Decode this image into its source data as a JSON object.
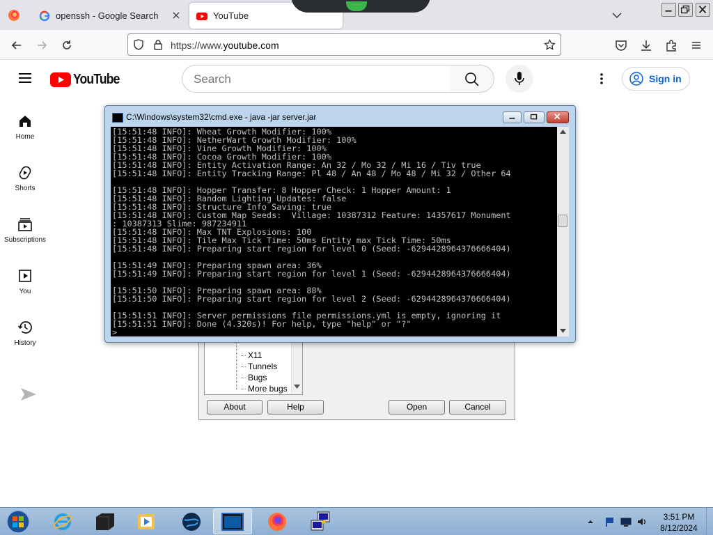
{
  "browser": {
    "tabs": [
      {
        "title": "openssh - Google Search"
      },
      {
        "title": "YouTube"
      }
    ],
    "url_scheme": "https://www.",
    "url_host": "youtube.com"
  },
  "youtube": {
    "logo_text": "YouTube",
    "search_placeholder": "Search",
    "sign_in_label": "Sign in",
    "sidebar": [
      {
        "label": "Home",
        "icon": "home-icon"
      },
      {
        "label": "Shorts",
        "icon": "shorts-icon"
      },
      {
        "label": "Subscriptions",
        "icon": "subscriptions-icon"
      },
      {
        "label": "You",
        "icon": "you-icon"
      },
      {
        "label": "History",
        "icon": "history-icon"
      }
    ],
    "brand_color": "#ff0000",
    "link_color": "#065fd4"
  },
  "dialog": {
    "tree_items": [
      "X11",
      "Tunnels",
      "Bugs",
      "More bugs"
    ],
    "buttons": {
      "about": "About",
      "help": "Help",
      "open": "Open",
      "cancel": "Cancel"
    }
  },
  "cmd": {
    "title": "C:\\Windows\\system32\\cmd.exe - java  -jar server.jar",
    "lines": [
      "[15:51:48 INFO]: Wheat Growth Modifier: 100%",
      "[15:51:48 INFO]: NetherWart Growth Modifier: 100%",
      "[15:51:48 INFO]: Vine Growth Modifier: 100%",
      "[15:51:48 INFO]: Cocoa Growth Modifier: 100%",
      "[15:51:48 INFO]: Entity Activation Range: An 32 / Mo 32 / Mi 16 / Tiv true",
      "[15:51:48 INFO]: Entity Tracking Range: Pl 48 / An 48 / Mo 48 / Mi 32 / Other 64",
      "",
      "[15:51:48 INFO]: Hopper Transfer: 8 Hopper Check: 1 Hopper Amount: 1",
      "[15:51:48 INFO]: Random Lighting Updates: false",
      "[15:51:48 INFO]: Structure Info Saving: true",
      "[15:51:48 INFO]: Custom Map Seeds:  Village: 10387312 Feature: 14357617 Monument",
      ": 10387313 Slime: 987234911",
      "[15:51:48 INFO]: Max TNT Explosions: 100",
      "[15:51:48 INFO]: Tile Max Tick Time: 50ms Entity max Tick Time: 50ms",
      "[15:51:48 INFO]: Preparing start region for level 0 (Seed: -6294428964376666404)",
      "",
      "[15:51:49 INFO]: Preparing spawn area: 36%",
      "[15:51:49 INFO]: Preparing start region for level 1 (Seed: -6294428964376666404)",
      "",
      "[15:51:50 INFO]: Preparing spawn area: 88%",
      "[15:51:50 INFO]: Preparing start region for level 2 (Seed: -6294428964376666404)",
      "",
      "[15:51:51 INFO]: Server permissions file permissions.yml is empty, ignoring it",
      "[15:51:51 INFO]: Done (4.320s)! For help, type \"help\" or \"?\"",
      ">"
    ]
  },
  "taskbar": {
    "time": "3:51 PM",
    "date": "8/12/2024"
  }
}
